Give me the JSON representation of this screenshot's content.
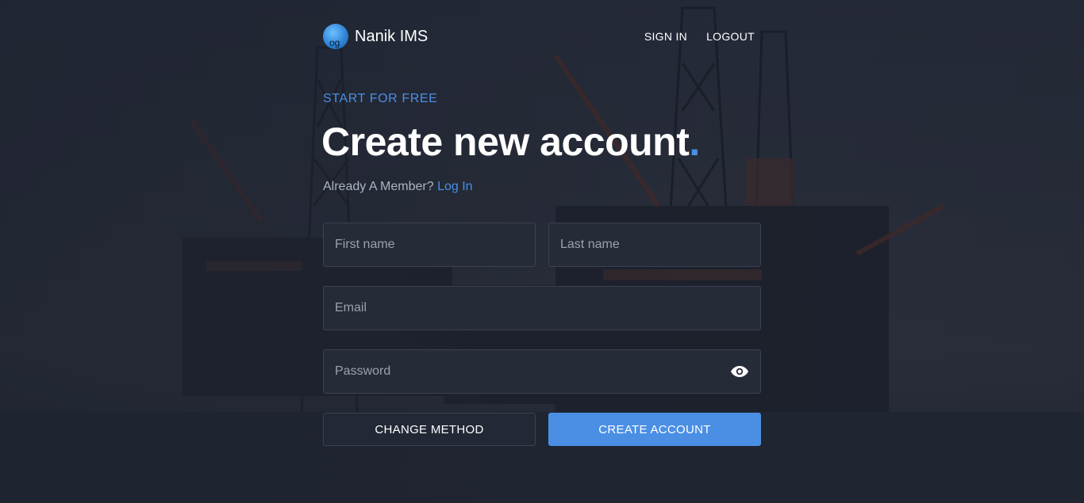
{
  "header": {
    "brand_name": "Nanik IMS",
    "nav": {
      "sign_in": "SIGN IN",
      "logout": "LOGOUT"
    }
  },
  "hero": {
    "eyebrow": "START FOR FREE",
    "title": "Create new account",
    "title_dot": ".",
    "member_text": "Already A Member?",
    "login_link": "Log In"
  },
  "form": {
    "first_name": {
      "placeholder": "First name",
      "value": ""
    },
    "last_name": {
      "placeholder": "Last name",
      "value": ""
    },
    "email": {
      "placeholder": "Email",
      "value": ""
    },
    "password": {
      "placeholder": "Password",
      "value": ""
    },
    "password_toggle_icon": "eye-icon"
  },
  "buttons": {
    "change_method": "CHANGE METHOD",
    "create_account": "CREATE ACCOUNT"
  },
  "colors": {
    "accent": "#4a8fe4",
    "background": "#1e2330",
    "field_bg": "#262b38"
  }
}
